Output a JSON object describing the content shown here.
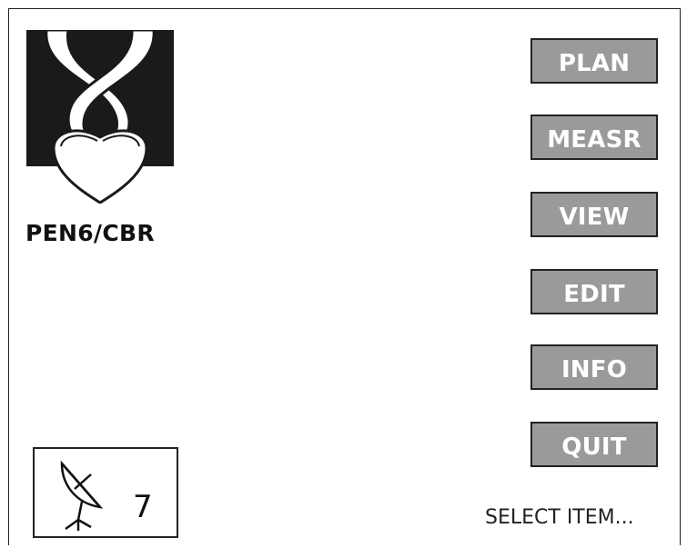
{
  "station": {
    "label": "PEN6/CBR"
  },
  "menu": {
    "buttons": [
      {
        "label": "PLAN"
      },
      {
        "label": "MEASR"
      },
      {
        "label": "VIEW"
      },
      {
        "label": "EDIT"
      },
      {
        "label": "INFO"
      },
      {
        "label": "QUIT"
      }
    ],
    "button_color": "#9a9a9a",
    "button_text_color": "#ffffff"
  },
  "satellites": {
    "icon": "satellite-dish-icon",
    "count": "7"
  },
  "status": {
    "text": "SELECT ITEM..."
  },
  "logo": {
    "icon": "twisted-ribbon-logo"
  }
}
